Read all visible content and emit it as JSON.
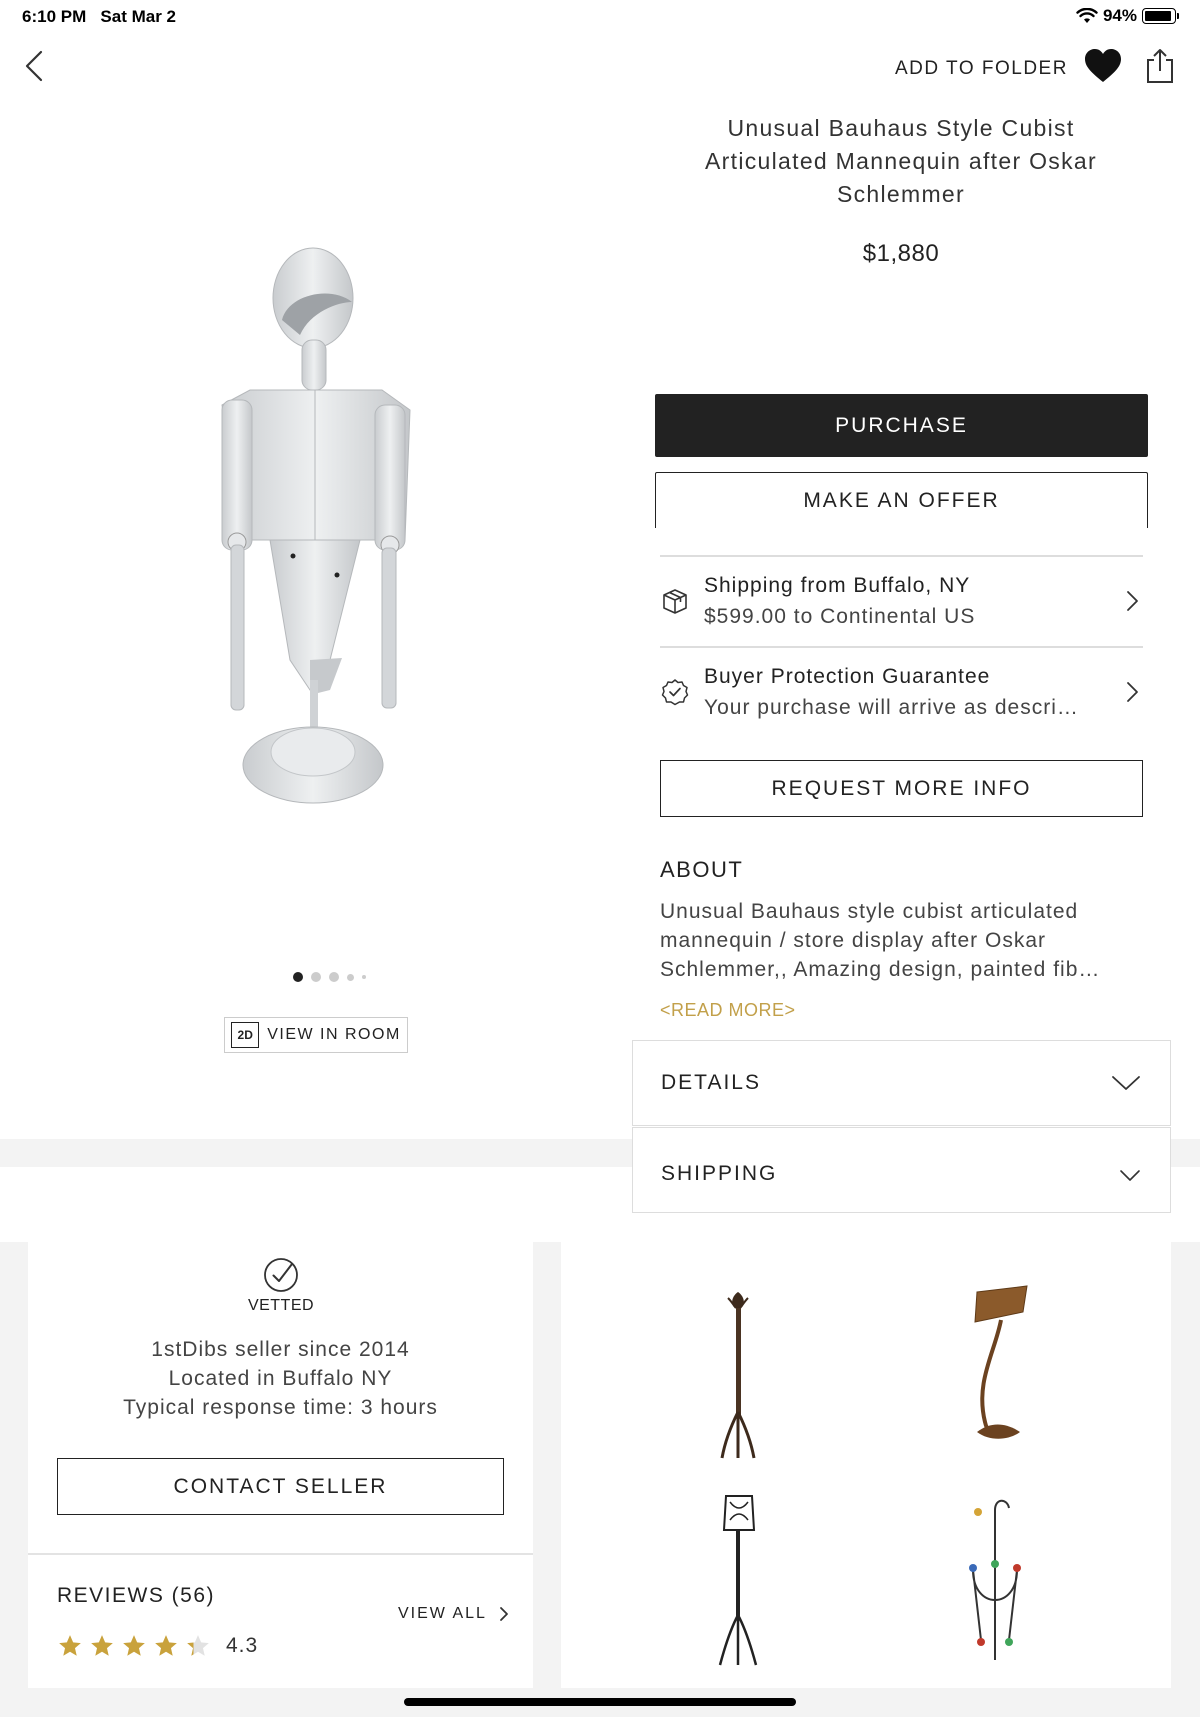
{
  "status_bar": {
    "time": "6:10 PM",
    "date": "Sat Mar 2",
    "battery": "94%",
    "battery_level": 0.94
  },
  "top_bar": {
    "add_to_folder": "ADD TO FOLDER",
    "icons": [
      "back-chevron-icon",
      "heart-icon",
      "share-icon"
    ]
  },
  "product": {
    "title_lines": [
      "Unusual Bauhaus Style Cubist",
      "Articulated Mannequin after Oskar",
      "Schlemmer"
    ],
    "price": "$1,880"
  },
  "gallery": {
    "image_count": 5,
    "active_index": 0,
    "view_in_room_badge": "2D",
    "view_in_room_label": "VIEW IN ROOM"
  },
  "actions": {
    "purchase": "PURCHASE",
    "make_offer": "MAKE AN OFFER",
    "request_info": "REQUEST MORE INFO"
  },
  "shipping_row": {
    "line1": "Shipping from Buffalo, NY",
    "line2": "$599.00 to Continental US"
  },
  "protection_row": {
    "line1": "Buyer Protection Guarantee",
    "line2": "Your purchase will arrive as descri…"
  },
  "about": {
    "heading": "ABOUT",
    "lines": [
      "Unusual Bauhaus style cubist articulated",
      "mannequin / store display after Oskar",
      "Schlemmer,, Amazing design, painted fib…"
    ],
    "read_more": "<READ MORE>"
  },
  "accordions": {
    "details": "DETAILS",
    "shipping": "SHIPPING"
  },
  "seller": {
    "vetted": "VETTED",
    "lines": [
      "1stDibs seller since 2014",
      "Located in Buffalo NY",
      "Typical response time: 3 hours"
    ],
    "contact": "CONTACT SELLER",
    "reviews_heading": "REVIEWS (56)",
    "view_all": "VIEW ALL",
    "rating": "4.3",
    "rating_value": 4.3,
    "star_color": "#c9a23c"
  },
  "colors": {
    "accent_gold": "#c2a04a",
    "button_dark": "#222222",
    "band_gray": "#f3f3f3"
  }
}
